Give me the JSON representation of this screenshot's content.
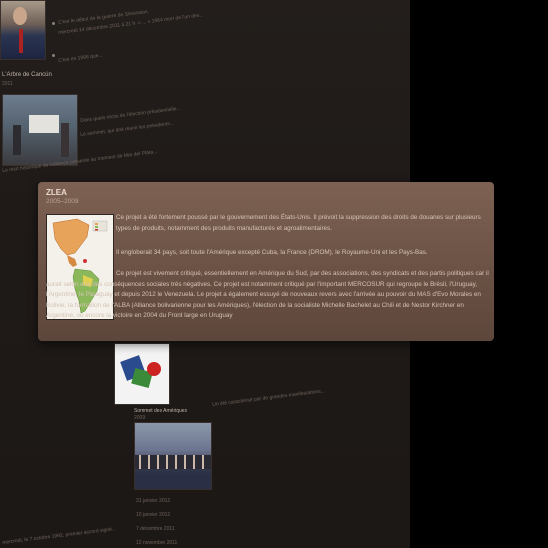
{
  "background": {
    "lines": [
      "C'est le début de la guerre de Sécession.",
      "mercredi 14 décembre 2011 à 21 h. « ... » 1964 mort de l'un des...",
      "C'est en 1998 que...",
      "Dans quels récits de l'élection présidentielle...",
      "Le sommet, qui doit réunir les présidents...",
      "Le récit historique de l'alliance présenté au moment de Mar del Plata...",
      "Un été caractérisé par de grandes manifestations..."
    ],
    "event1": {
      "title": "L'Arbre de Cancún",
      "sub": "2011"
    },
    "event2": {
      "title": "Sommet des Amériques",
      "sub": "2009"
    },
    "dates": [
      "31 janvier 2012",
      "10 janvier 2012",
      "7 décembre 2011",
      "12 novembre 2011"
    ],
    "bottom_line": "mercredi, le 7 octobre 1992, premier accord signé..."
  },
  "popup": {
    "title": "ZLEA",
    "years": "2005–2009",
    "map_icon": "americas-trade-map-icon",
    "paragraphs": [
      "Ce projet a été fortement poussé par le gouvernement des États-Unis. Il prévoit la suppression des droits de douanes sur plusieurs types de produits, notamment des produits manufacturés et agroalimentaires.",
      "Il engloberait 34 pays, soit toute l'Amérique excepté Cuba, la France (DROM), le Royaume-Uni et les Pays-Bas.",
      "Ce projet est vivement critiqué, essentiellement en Amérique du Sud, par des associations, des syndicats et des partis politiques car il aurait selon eux des conséquences sociales très négatives. Ce projet est notamment critiqué par l'important MERCOSUR qui regroupe le Brésil, l'Uruguay, l'Argentine, le Paraguay et depuis 2012 le Venezuela. Le projet a également essuyé de nouveaux revers avec l'arrivée au pouvoir du MAS d'Evo Morales en Bolivie, la formation de l'ALBA (Alliance bolivarienne pour les Amériques), l'élection de la socialiste Michelle Bachelet au Chili et de Nestor Kirchner en Argentine, ou encore la victoire en 2004 du Front large en Uruguay"
    ]
  },
  "colors": {
    "card_top": "#7d6253",
    "card_bottom": "#5d463b",
    "page_bg": "#211c19",
    "side_bg": "#000000"
  }
}
